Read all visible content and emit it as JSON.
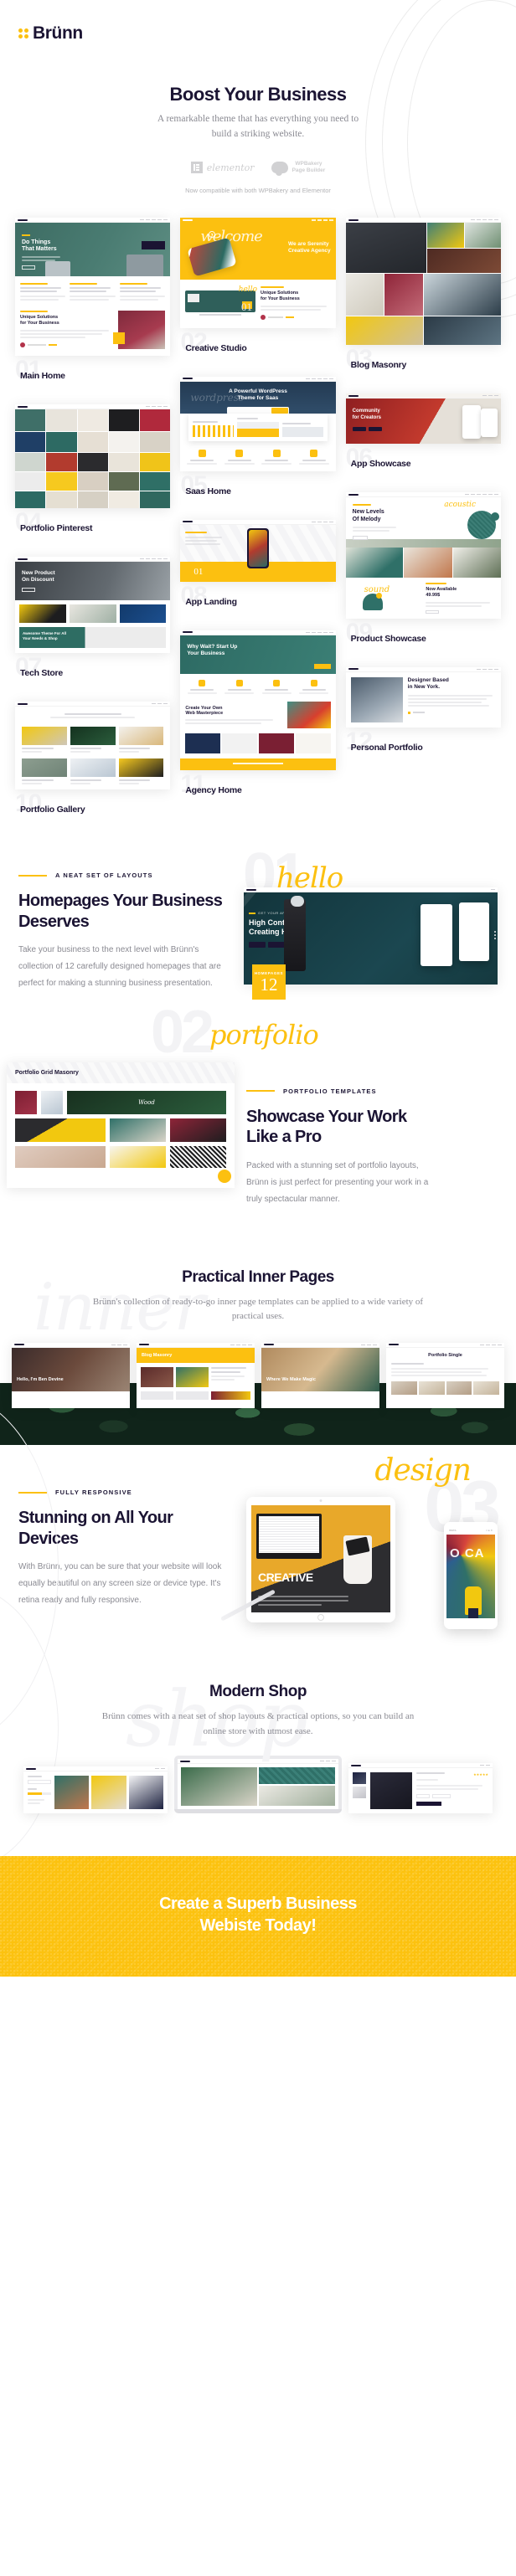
{
  "brand": {
    "name": "Brünn",
    "accent": "#fcc010",
    "ink": "#1b1433"
  },
  "hero": {
    "title": "Boost Your Business",
    "subtitle": "A remarkable theme that has everything you need to build a striking website.",
    "builders": [
      {
        "name": "elementor",
        "icon": "elementor-icon"
      },
      {
        "name": "WPBakery\nPage Builder",
        "line1": "WPBakery",
        "line2": "Page Builder",
        "icon": "wpbakery-cloud-icon"
      }
    ],
    "compat_note": "Now compatible with both WPBakery and Elementor"
  },
  "demos": {
    "columns": [
      [
        {
          "num": "01",
          "name": "Main Home"
        },
        {
          "num": "04",
          "name": "Portfolio Pinterest"
        },
        {
          "num": "07",
          "name": "Tech Store"
        },
        {
          "num": "10",
          "name": "Portfolio Gallery"
        }
      ],
      [
        {
          "num": "02",
          "name": "Creative Studio"
        },
        {
          "num": "05",
          "name": "Saas Home"
        },
        {
          "num": "08",
          "name": "App Landing"
        },
        {
          "num": "11",
          "name": "Agency Home"
        }
      ],
      [
        {
          "num": "03",
          "name": "Blog Masonry"
        },
        {
          "num": "06",
          "name": "App Showcase"
        },
        {
          "num": "09",
          "name": "Product Showcase"
        },
        {
          "num": "12",
          "name": "Personal Portfolio"
        }
      ]
    ],
    "mock_texts": {
      "main_home_headline": "Do Things That Matters",
      "main_home_sub": "Unique Solutions for Your Business",
      "creative_welcome": "welcome",
      "creative_headline": "We are Serenity Creative Agency",
      "creative_hello": "hello",
      "saas_headline": "A Powerful WordPress Theme for Saas",
      "app_showcase_headline": "Community for Creators",
      "pinterest_headline": "New Product On Discount",
      "product_headline": "New Levels Of Melody",
      "product_sub": "Now Available 49.99$",
      "app_landing_headline": "Why Wait? Start Up Your Business",
      "app_landing_sub": "Create Your Own Web Masterpiece",
      "tech_store_sub": "Awesome Theme For All Your Needs & Shop",
      "personal_headline": "Designer Based in New York.",
      "app_num": "01"
    }
  },
  "sections": {
    "homepages": {
      "eyebrow": "A NEAT SET OF LAYOUTS",
      "title": "Homepages Your Business Deserves",
      "body": "Take your business to the next level with Brünn's collection of 12 carefully designed homepages that are perfect for making a stunning business presentation.",
      "script_word": "hello",
      "ghost_number": "01",
      "badge_label": "HOMEPAGES",
      "badge_number": "12",
      "preview_headline": "High Contrast Creating Here"
    },
    "portfolio": {
      "eyebrow": "PORTFOLIO TEMPLATES",
      "title": "Showcase Your Work Like a Pro",
      "body": "Packed with a stunning set of portfolio layouts, Brünn is just perfect for presenting your work in a truly spectacular manner.",
      "script_word": "portfolio",
      "ghost_number": "02",
      "preview_label": "Portfolio Grid Masonry",
      "tile_word": "Wood"
    },
    "inner_pages": {
      "title": "Practical Inner Pages",
      "body": "Brünn's collection of ready-to-go inner page templates can be applied to a wide variety of practical uses.",
      "script_word": "inner",
      "shot_labels": [
        "Hello, I'm Ben Devine",
        "Blog Masonry",
        "Where We Make Magic",
        "Portfolio Single"
      ]
    },
    "responsive": {
      "eyebrow": "FULLY RESPONSIVE",
      "title": "Stunning on All Your Devices",
      "body": "With Brünn, you can be sure that your website will look equally beautiful on any screen size or device type. It's retina ready and fully responsive.",
      "script_word": "design",
      "ghost_number": "03",
      "tablet_word": "CREATIVE",
      "phone_word": "O CA"
    },
    "shop": {
      "title": "Modern Shop",
      "body": "Brünn comes with a neat set of shop layouts & practical options, so you can build an online store with utmost ease.",
      "script_word": "shop"
    }
  },
  "cta": {
    "line1": "Create a Superb Business",
    "line2": "Webiste Today!",
    "background": "#fcc20f"
  }
}
